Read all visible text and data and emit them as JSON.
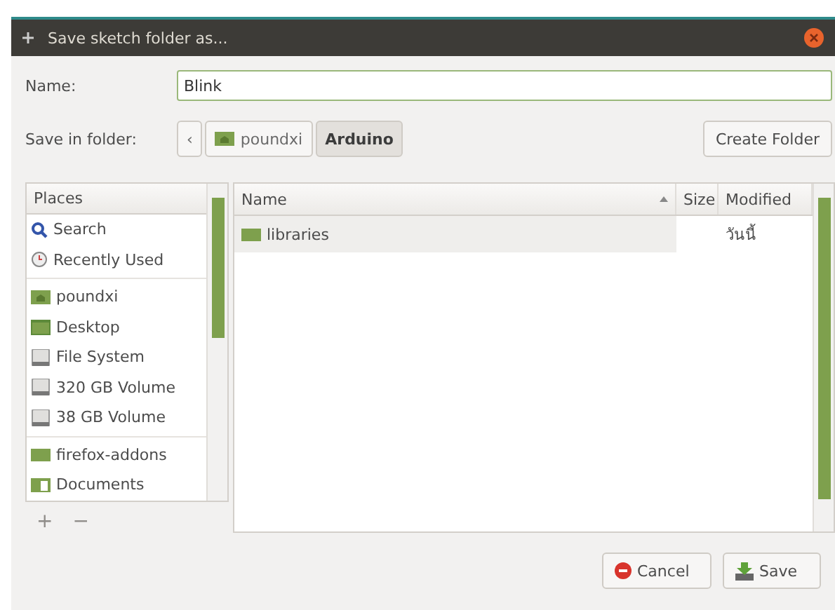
{
  "window": {
    "title": "Save sketch folder as..."
  },
  "name_field": {
    "label": "Name:",
    "value": "Blink"
  },
  "folder_bar": {
    "label": "Save in folder:",
    "back": "‹",
    "crumbs": [
      {
        "label": "poundxi",
        "kind": "home",
        "selected": false
      },
      {
        "label": "Arduino",
        "selected": true
      }
    ],
    "create_button": "Create Folder"
  },
  "places": {
    "header": "Places",
    "groups": [
      [
        {
          "label": "Search",
          "kind": "search"
        },
        {
          "label": "Recently Used",
          "kind": "recent"
        }
      ],
      [
        {
          "label": "poundxi",
          "kind": "home"
        },
        {
          "label": "Desktop",
          "kind": "desktop"
        },
        {
          "label": "File System",
          "kind": "drive"
        },
        {
          "label": "320 GB Volume",
          "kind": "drive"
        },
        {
          "label": "38 GB Volume",
          "kind": "drive"
        }
      ],
      [
        {
          "label": "firefox-addons",
          "kind": "folder"
        },
        {
          "label": "Documents",
          "kind": "documents"
        }
      ]
    ],
    "add": {
      "label": "+",
      "disabled": true
    },
    "remove": {
      "label": "−",
      "disabled": true
    }
  },
  "files": {
    "columns": [
      "Name",
      "Size",
      "Modified"
    ],
    "rows": [
      {
        "name": "libraries",
        "size": "",
        "modified": "วันนี้",
        "selected": true
      }
    ]
  },
  "buttons": [
    {
      "label": "Cancel",
      "kind": "cancel"
    },
    {
      "label": "Save",
      "kind": "save"
    }
  ]
}
